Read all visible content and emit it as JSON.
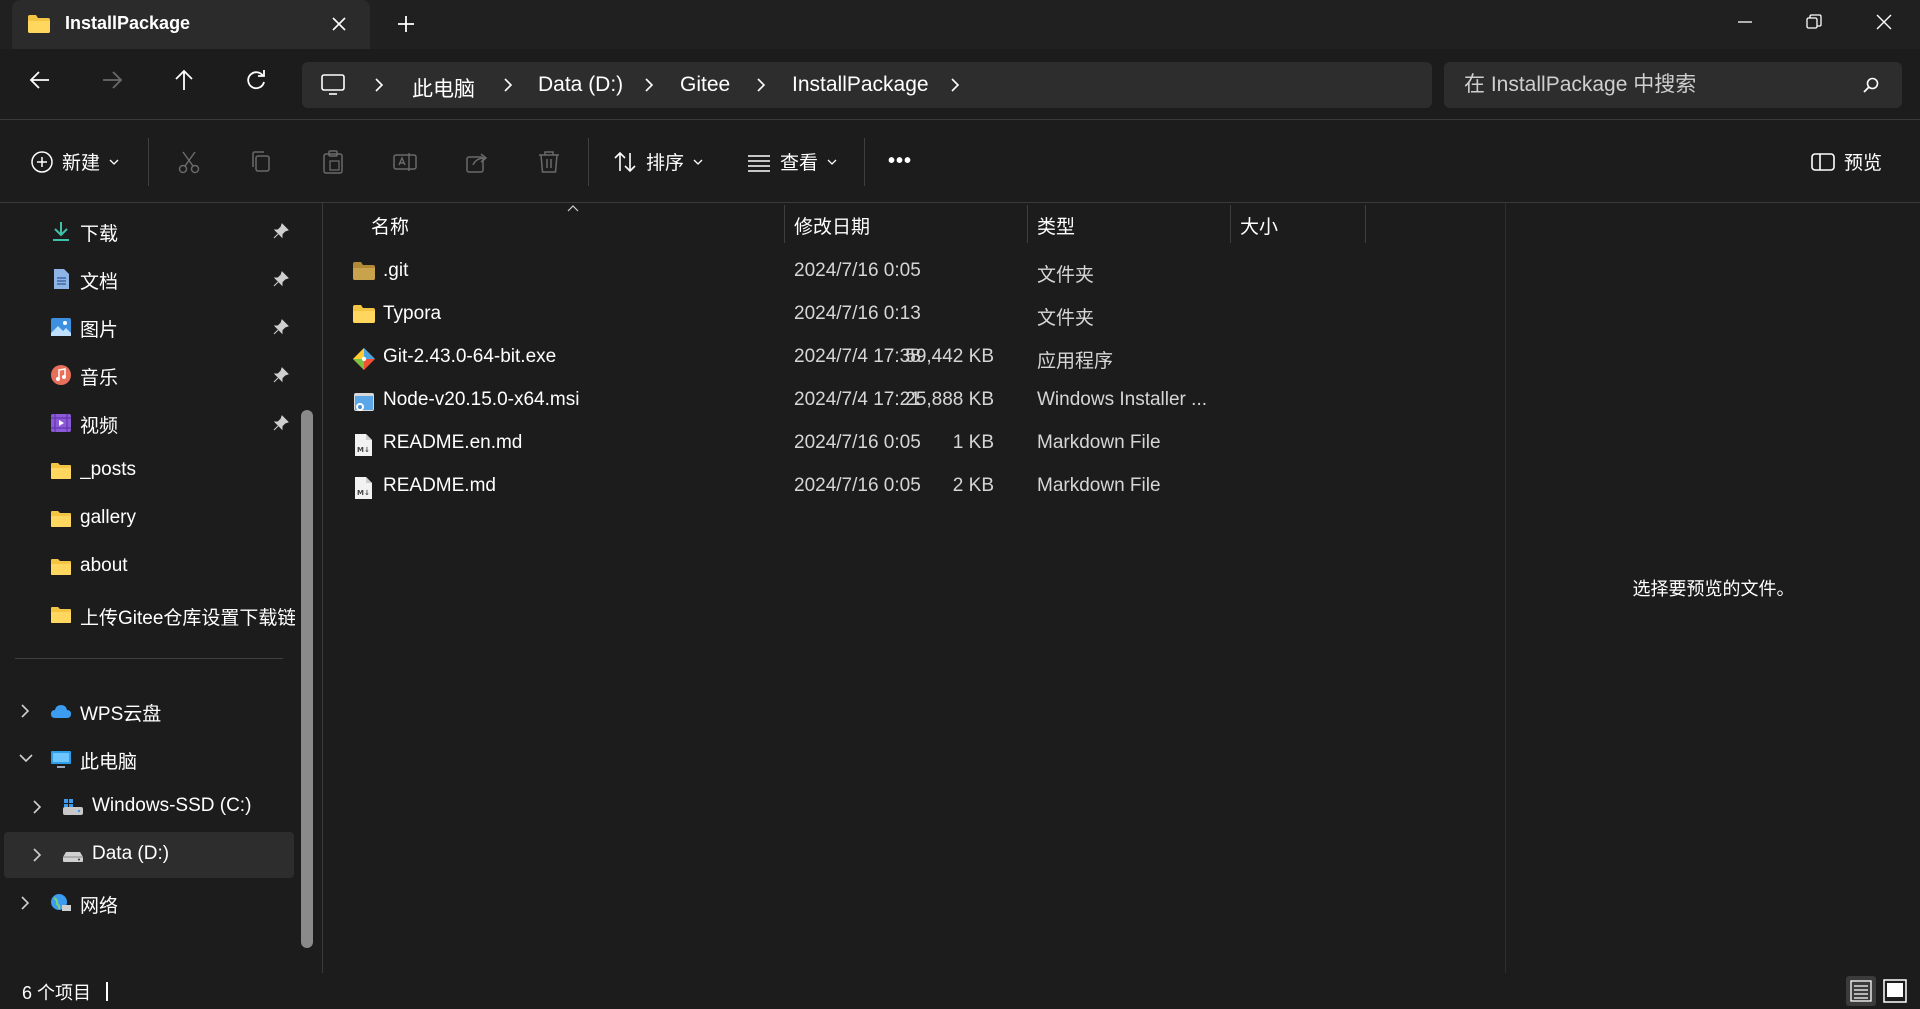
{
  "colors": {
    "background": "#1c1c1c",
    "titlebar": "#202020",
    "tab_active": "#2b2b2b",
    "address_bg": "#2d2d2d",
    "folder": "#f4c542"
  },
  "window": {
    "tab_title": "InstallPackage",
    "minimize_icon": "minimize-icon",
    "maximize_icon": "restore-icon",
    "close_icon": "close-icon"
  },
  "address": {
    "crumbs": [
      "此电脑",
      "Data (D:)",
      "Gitee",
      "InstallPackage"
    ]
  },
  "search": {
    "placeholder": "在 InstallPackage 中搜索"
  },
  "toolbar": {
    "new_label": "新建",
    "sort_label": "排序",
    "view_label": "查看",
    "more_label": "•••",
    "preview_label": "预览"
  },
  "sidebar": {
    "quick": [
      {
        "label": "下载",
        "icon": "download-icon",
        "pinned": true
      },
      {
        "label": "文档",
        "icon": "document-icon",
        "pinned": true
      },
      {
        "label": "图片",
        "icon": "pictures-icon",
        "pinned": true
      },
      {
        "label": "音乐",
        "icon": "music-icon",
        "pinned": true
      },
      {
        "label": "视频",
        "icon": "video-icon",
        "pinned": true
      },
      {
        "label": "_posts",
        "icon": "folder-icon",
        "pinned": false
      },
      {
        "label": "gallery",
        "icon": "folder-icon",
        "pinned": false
      },
      {
        "label": "about",
        "icon": "folder-icon",
        "pinned": false
      },
      {
        "label": "上传Gitee仓库设置下载链接",
        "icon": "folder-icon",
        "pinned": false
      }
    ],
    "tree": [
      {
        "label": "WPS云盘",
        "icon": "cloud-icon"
      },
      {
        "label": "此电脑",
        "icon": "pc-icon"
      },
      {
        "label": "Windows-SSD (C:)",
        "icon": "drive-c-icon"
      },
      {
        "label": "Data (D:)",
        "icon": "drive-icon"
      },
      {
        "label": "网络",
        "icon": "network-icon"
      }
    ]
  },
  "columns": {
    "name": "名称",
    "date": "修改日期",
    "type": "类型",
    "size": "大小"
  },
  "files": [
    {
      "name": ".git",
      "date": "2024/7/16 0:05",
      "type": "文件夹",
      "size": "",
      "icon": "folder-icon"
    },
    {
      "name": "Typora",
      "date": "2024/7/16 0:13",
      "type": "文件夹",
      "size": "",
      "icon": "folder-icon"
    },
    {
      "name": "Git-2.43.0-64-bit.exe",
      "date": "2024/7/4 17:38",
      "type": "应用程序",
      "size": "59,442 KB",
      "icon": "git-exe-icon"
    },
    {
      "name": "Node-v20.15.0-x64.msi",
      "date": "2024/7/4 17:21",
      "type": "Windows Installer ...",
      "size": "25,888 KB",
      "icon": "msi-icon"
    },
    {
      "name": "README.en.md",
      "date": "2024/7/16 0:05",
      "type": "Markdown File",
      "size": "1 KB",
      "icon": "markdown-icon"
    },
    {
      "name": "README.md",
      "date": "2024/7/16 0:05",
      "type": "Markdown File",
      "size": "2 KB",
      "icon": "markdown-icon"
    }
  ],
  "preview": {
    "message": "选择要预览的文件。"
  },
  "status": {
    "count": "6 个项目"
  }
}
